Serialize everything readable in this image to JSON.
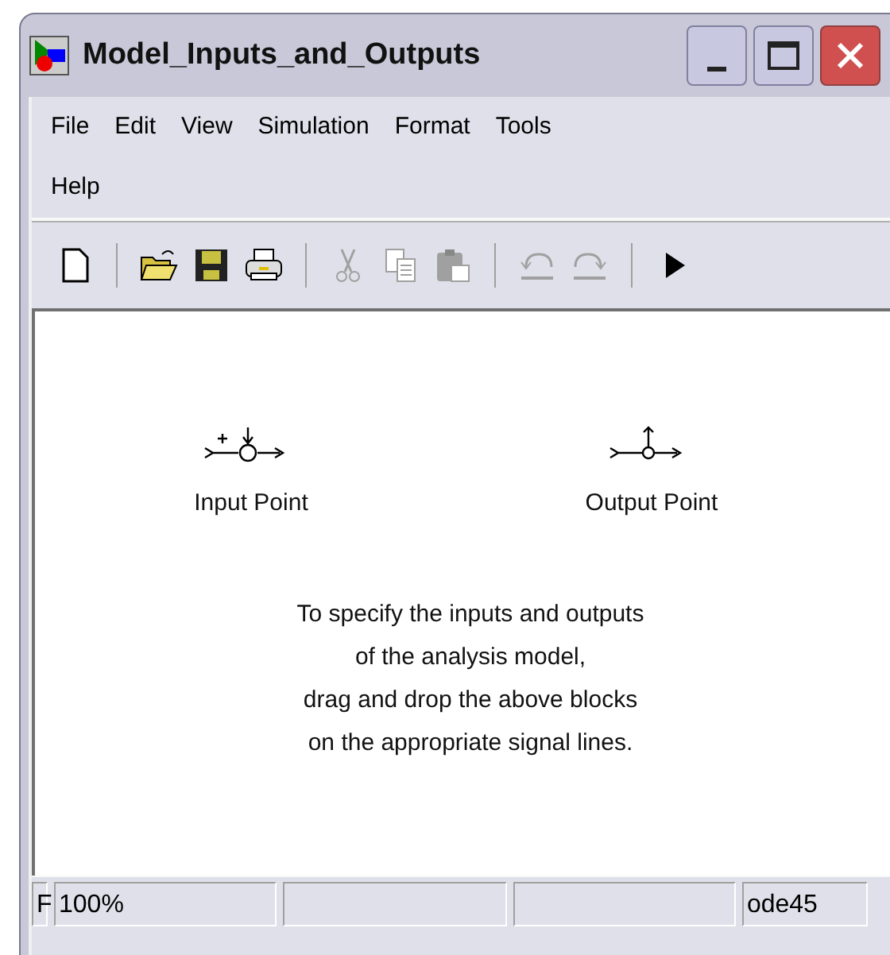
{
  "window": {
    "title": "Model_Inputs_and_Outputs"
  },
  "menu": [
    "File",
    "Edit",
    "View",
    "Simulation",
    "Format",
    "Tools",
    "Help"
  ],
  "toolbar": [
    {
      "kind": "new",
      "disabled": false
    },
    {
      "kind": "separator"
    },
    {
      "kind": "open",
      "disabled": false
    },
    {
      "kind": "save",
      "disabled": false
    },
    {
      "kind": "print",
      "disabled": false
    },
    {
      "kind": "separator"
    },
    {
      "kind": "cut",
      "disabled": true
    },
    {
      "kind": "copy",
      "disabled": true
    },
    {
      "kind": "paste",
      "disabled": true
    },
    {
      "kind": "separator"
    },
    {
      "kind": "undo",
      "disabled": true
    },
    {
      "kind": "redo",
      "disabled": true
    },
    {
      "kind": "separator"
    },
    {
      "kind": "run",
      "disabled": false
    }
  ],
  "blocks": [
    {
      "kind": "input",
      "label": "Input Point"
    },
    {
      "kind": "output",
      "label": "Output Point"
    }
  ],
  "instructions": "To specify the inputs and outputs\nof the analysis model,\ndrag and drop the above blocks\non the appropriate signal lines.",
  "status_bar": {
    "pane_1": "F",
    "zoom": "100%",
    "solver": "ode45"
  }
}
